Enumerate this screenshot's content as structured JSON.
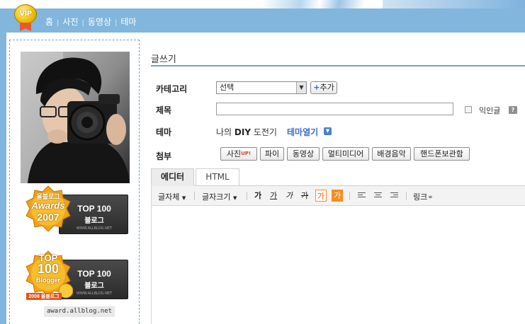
{
  "header": {
    "badge": "VIP",
    "nav": [
      "홈",
      "사진",
      "동영상",
      "테마"
    ]
  },
  "sidebar": {
    "awards": [
      {
        "medal_lines": [
          "올블로그",
          "Awards",
          "2007"
        ],
        "box_title": "TOP 100",
        "box_sub": "블로그",
        "box_url": "WWW.ALLBLOG.NET"
      },
      {
        "medal_lines": [
          "TOP",
          "100",
          "Blogger",
          "2008 올블로그"
        ],
        "box_title": "TOP 100",
        "box_sub": "블로그",
        "box_url": "WWW.ALLBLOG.NET"
      }
    ],
    "award_caption": "award.allblog.net"
  },
  "form": {
    "page_title": "글쓰기",
    "category_label": "카테고리",
    "category_value": "선택",
    "add_label": "추가",
    "title_label": "제목",
    "anonymous_label": "익인글",
    "help_label": "?",
    "theme_label": "테마",
    "theme_prefix": "나의 ",
    "theme_bold": "DIY",
    "theme_suffix": " 도전기",
    "theme_link": "테마열기",
    "attach_label": "첨부",
    "attach_photo": "사진",
    "attach_photo_badge": "UP!",
    "attach_buttons": [
      "파이",
      "동영상",
      "멀티미디어",
      "배경음악",
      "핸드폰보관함"
    ]
  },
  "editor": {
    "tabs": [
      "에디터",
      "HTML"
    ],
    "font_label": "글자체",
    "size_label": "글자크기",
    "format_buttons": [
      "가",
      "가",
      "가",
      "가",
      "가",
      "가"
    ],
    "link_label": "링크"
  },
  "colors": {
    "nav_blue": "#82b6dc",
    "border_blue": "#6aa7d4",
    "link_blue": "#3a6fc4",
    "highlight_orange": "#f58d1f"
  }
}
